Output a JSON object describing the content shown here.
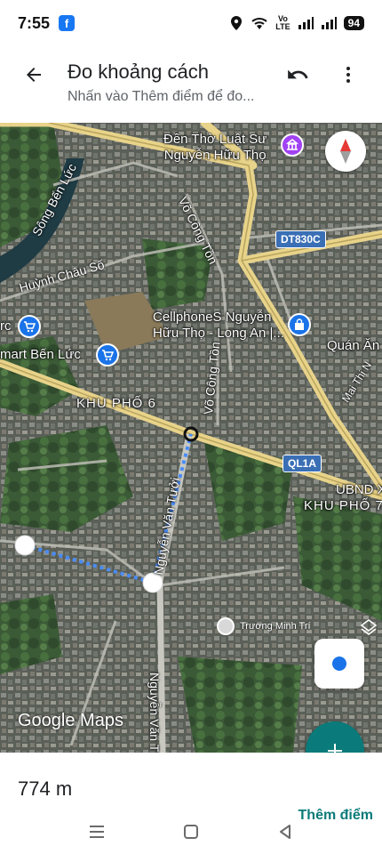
{
  "status_bar": {
    "time": "7:55",
    "facebook_badge": "f",
    "volte_top": "Vo",
    "volte_bottom": "LTE",
    "battery": "94",
    "icons": [
      "location-pin-icon",
      "wifi-icon",
      "signal-icon",
      "signal-icon"
    ]
  },
  "header": {
    "title": "Đo khoảng cách",
    "subtitle": "Nhấn vào Thêm điểm để đo...",
    "back_icon": "arrow-left-icon",
    "undo_icon": "undo-icon",
    "more_icon": "more-vert-icon"
  },
  "map": {
    "labels": {
      "den_tho": "Đền Thờ Luật Sư\nNguyễn Hữu Thọ",
      "song_ben_luc": "Sông Bến Lức",
      "huynh_chau_so": "Huỳnh Châu Số",
      "vo_cong_ton_top": "Võ Công Tồn",
      "vo_cong_ton_mid": "Võ Công Tồn",
      "cellphones": "CellphoneS Nguyễn\nHữu Thọ - Long An |...",
      "rc_fragment": "rc",
      "smart_ben_luc": "mart Bến Lức",
      "quan_an": "Quán Ăn",
      "mai_thi_n": "Mai Thị N",
      "khu_pho_6": "KHU PHỐ 6",
      "nguyen_van_tuoi": "Nguyễn Văn Tưởi",
      "nguyen_van_t": "Nguyễn Văn T",
      "ubnd": "UBND X",
      "khu_pho_7": "KHU PHỐ 7"
    },
    "route_badges": {
      "dt830c": "DT830C",
      "ql1a": "QL1A"
    },
    "google_logo": "Google Maps",
    "user_name": "Trương Minh Trí",
    "colors": {
      "major_road": "#e8d38a",
      "measure_line": "#4a8cf7",
      "fab": "#0b7a7a",
      "poi_blue": "#1a73e8",
      "poi_purple": "#a142f4"
    }
  },
  "bottom_sheet": {
    "distance": "774 m",
    "add_point": "Thêm điểm"
  },
  "nav_bar": {
    "icons": [
      "menu-icon",
      "home-square-icon",
      "back-triangle-icon"
    ]
  }
}
